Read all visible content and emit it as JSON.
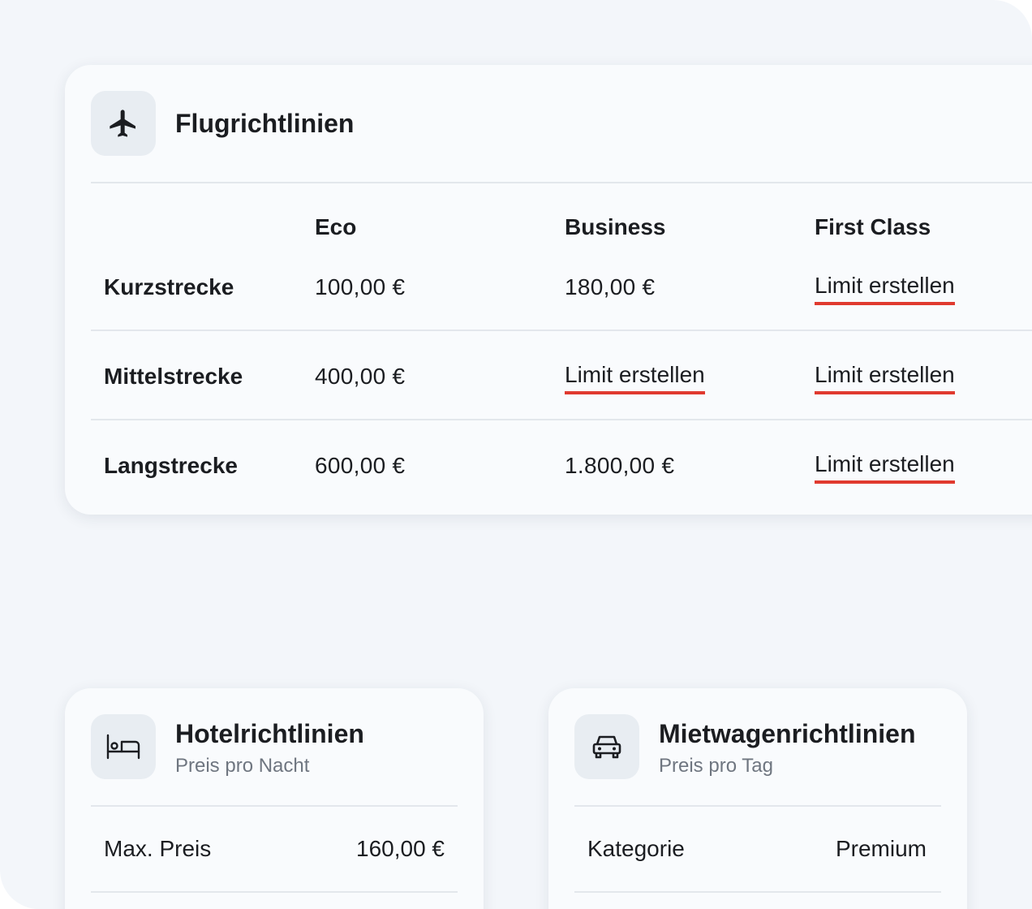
{
  "flight": {
    "icon": "airplane-icon",
    "title": "Flugrichtlinien",
    "columns": [
      "Eco",
      "Business",
      "First Class"
    ],
    "rows": [
      {
        "label": "Kurzstrecke",
        "cells": [
          "100,00 €",
          "180,00 €",
          "Limit erstellen"
        ]
      },
      {
        "label": "Mittelstrecke",
        "cells": [
          "400,00 €",
          "Limit erstellen",
          "Limit erstellen"
        ]
      },
      {
        "label": "Langstrecke",
        "cells": [
          "600,00 €",
          "1.800,00 €",
          "Limit erstellen"
        ]
      }
    ]
  },
  "hotel": {
    "icon": "bed-icon",
    "title": "Hotelrichtlinien",
    "subtitle": "Preis pro Nacht",
    "label": "Max. Preis",
    "value": "160,00 €"
  },
  "car": {
    "icon": "car-icon",
    "title": "Mietwagenrichtlinien",
    "subtitle": "Preis pro Tag",
    "label": "Kategorie",
    "value": "Premium"
  },
  "colors": {
    "accent": "#e03a2f",
    "background": "#f3f6fa",
    "card": "#f9fbfd",
    "icon_tile": "#e8edf2"
  }
}
